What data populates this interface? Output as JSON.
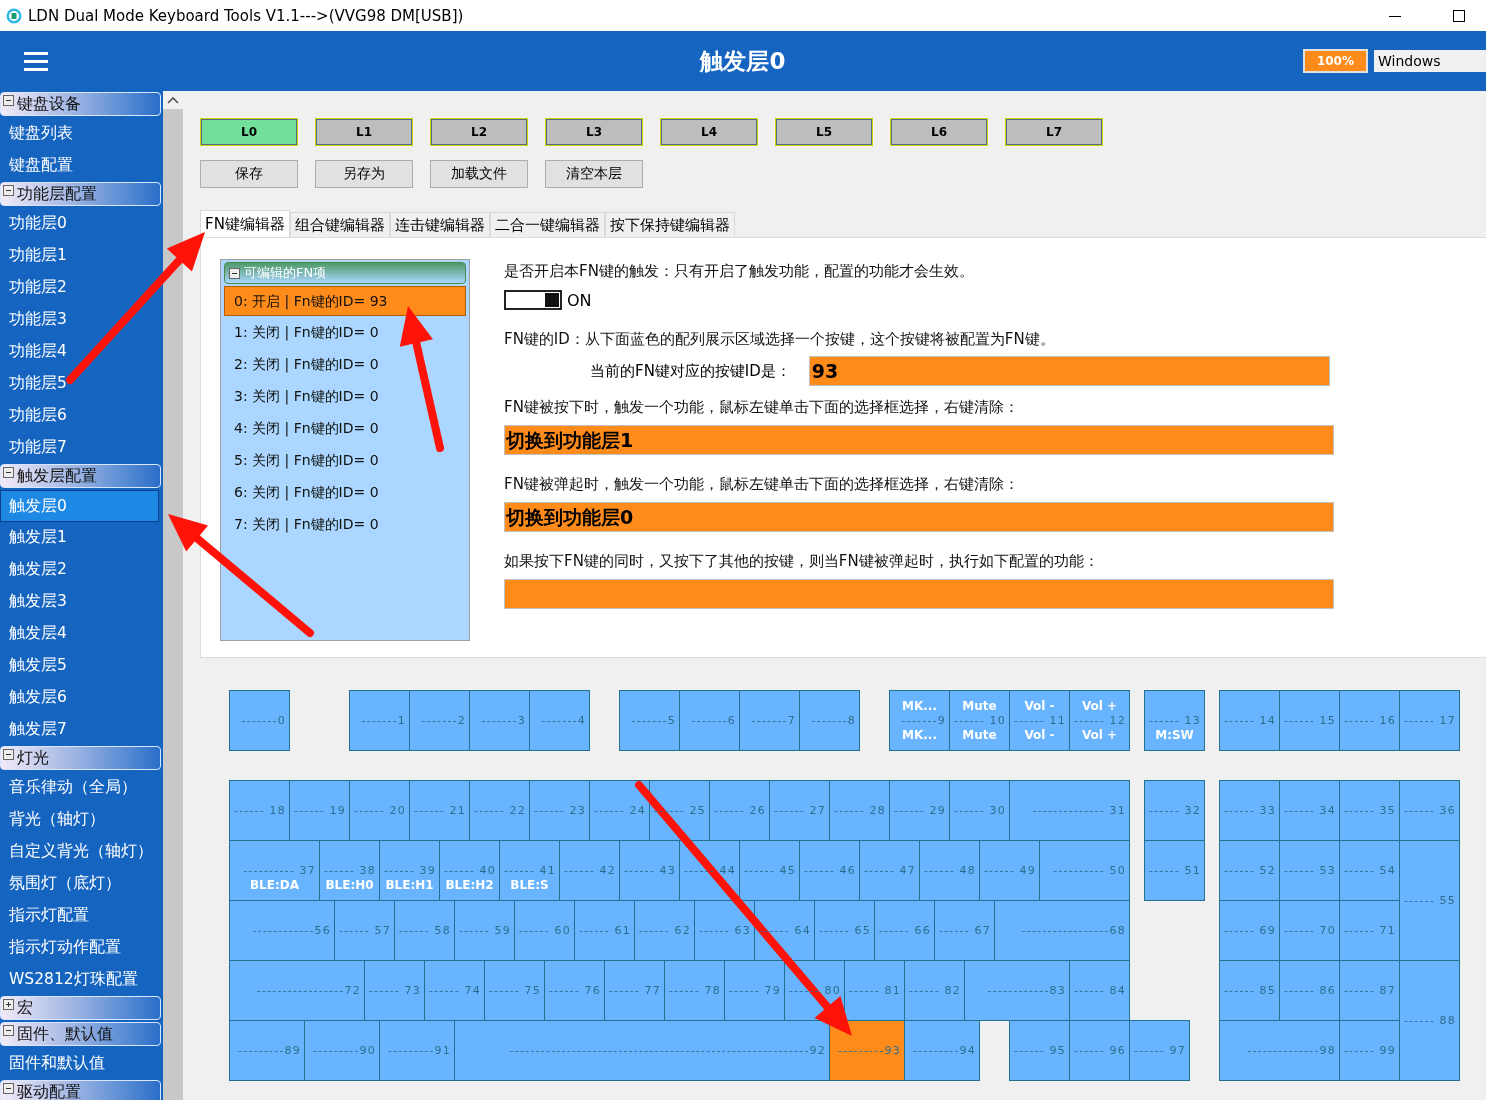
{
  "window": {
    "title": "LDN Dual Mode Keyboard Tools V1.1--->(VVG98 DM[USB])"
  },
  "header": {
    "title": "触发层0",
    "battery": "100%",
    "os": "Windows"
  },
  "sidebar": {
    "sections": [
      {
        "label": "键盘设备",
        "expanded": true,
        "children": [
          {
            "label": "键盘列表",
            "selected": false
          },
          {
            "label": "键盘配置",
            "selected": false
          }
        ]
      },
      {
        "label": "功能层配置",
        "expanded": true,
        "children": [
          {
            "label": "功能层0",
            "selected": false
          },
          {
            "label": "功能层1",
            "selected": false
          },
          {
            "label": "功能层2",
            "selected": false
          },
          {
            "label": "功能层3",
            "selected": false
          },
          {
            "label": "功能层4",
            "selected": false
          },
          {
            "label": "功能层5",
            "selected": false
          },
          {
            "label": "功能层6",
            "selected": false
          },
          {
            "label": "功能层7",
            "selected": false
          }
        ]
      },
      {
        "label": "触发层配置",
        "expanded": true,
        "children": [
          {
            "label": "触发层0",
            "selected": true
          },
          {
            "label": "触发层1",
            "selected": false
          },
          {
            "label": "触发层2",
            "selected": false
          },
          {
            "label": "触发层3",
            "selected": false
          },
          {
            "label": "触发层4",
            "selected": false
          },
          {
            "label": "触发层5",
            "selected": false
          },
          {
            "label": "触发层6",
            "selected": false
          },
          {
            "label": "触发层7",
            "selected": false
          }
        ]
      },
      {
        "label": "灯光",
        "expanded": true,
        "children": [
          {
            "label": "音乐律动（全局）",
            "selected": false
          },
          {
            "label": "背光（轴灯）",
            "selected": false
          },
          {
            "label": "自定义背光（轴灯）",
            "selected": false
          },
          {
            "label": "氛围灯（底灯）",
            "selected": false
          },
          {
            "label": "指示灯配置",
            "selected": false
          },
          {
            "label": "指示灯动作配置",
            "selected": false
          },
          {
            "label": "WS2812灯珠配置",
            "selected": false
          }
        ]
      },
      {
        "label": "宏",
        "expanded": false
      },
      {
        "label": "固件、默认值",
        "expanded": true,
        "children": [
          {
            "label": "固件和默认值",
            "selected": false
          }
        ]
      },
      {
        "label": "驱动配置",
        "expanded": true
      }
    ]
  },
  "layers": [
    {
      "label": "L0",
      "selected": true
    },
    {
      "label": "L1",
      "selected": false
    },
    {
      "label": "L2",
      "selected": false
    },
    {
      "label": "L3",
      "selected": false
    },
    {
      "label": "L4",
      "selected": false
    },
    {
      "label": "L5",
      "selected": false
    },
    {
      "label": "L6",
      "selected": false
    },
    {
      "label": "L7",
      "selected": false
    }
  ],
  "actions": [
    "保存",
    "另存为",
    "加载文件",
    "清空本层"
  ],
  "tabs": [
    {
      "label": "FN键编辑器",
      "selected": true
    },
    {
      "label": "组合键编辑器",
      "selected": false
    },
    {
      "label": "连击键编辑器",
      "selected": false
    },
    {
      "label": "二合一键编辑器",
      "selected": false
    },
    {
      "label": "按下保持键编辑器",
      "selected": false
    }
  ],
  "fn_list": {
    "title": "可编辑的FN项",
    "expanded": true,
    "items": [
      {
        "label": "0: 开启 | Fn键的ID= 93",
        "selected": true
      },
      {
        "label": "1: 关闭 | Fn键的ID= 0",
        "selected": false
      },
      {
        "label": "2: 关闭 | Fn键的ID= 0",
        "selected": false
      },
      {
        "label": "3: 关闭 | Fn键的ID= 0",
        "selected": false
      },
      {
        "label": "4: 关闭 | Fn键的ID= 0",
        "selected": false
      },
      {
        "label": "5: 关闭 | Fn键的ID= 0",
        "selected": false
      },
      {
        "label": "6: 关闭 | Fn键的ID= 0",
        "selected": false
      },
      {
        "label": "7: 关闭 | Fn键的ID= 0",
        "selected": false
      }
    ]
  },
  "fn_editor": {
    "enable_prompt": "是否开启本FN键的触发：只有开启了触发功能，配置的功能才会生效。",
    "toggle": {
      "on": true,
      "label": "ON"
    },
    "id_prompt": "FN键的ID：从下面蓝色的配列展示区域选择一个按键，这个按键将被配置为FN键。",
    "id_label": "当前的FN键对应的按键ID是：",
    "id_value": "93",
    "press_prompt": "FN键被按下时，触发一个功能，鼠标左键单击下面的选择框选择，右键清除：",
    "press_value": "切换到功能层1",
    "release_prompt": "FN键被弹起时，触发一个功能，鼠标左键单击下面的选择框选择，右键清除：",
    "release_value": "切换到功能层0",
    "combo_prompt": "如果按下FN键的同时，又按下了其他的按键，则当FN键被弹起时，执行如下配置的功能："
  },
  "keyboard": {
    "keys": [
      {
        "label": "-------0",
        "selected": false
      },
      {
        "label": "-------1",
        "selected": false
      },
      {
        "label": "-------2",
        "selected": false
      },
      {
        "label": "-------3",
        "selected": false
      },
      {
        "label": "-------4",
        "selected": false
      },
      {
        "label": "-------5",
        "selected": false
      },
      {
        "label": "-------6",
        "selected": false
      },
      {
        "label": "-------7",
        "selected": false
      },
      {
        "label": "-------8",
        "selected": false
      },
      {
        "label": "-------9",
        "top": "MK...",
        "bottom": "MK...",
        "selected": false
      },
      {
        "label": "------ 10",
        "top": "Mute",
        "bottom": "Mute",
        "selected": false
      },
      {
        "label": "------ 11",
        "top": "Vol -",
        "bottom": "Vol -",
        "selected": false
      },
      {
        "label": "------ 12",
        "top": "Vol +",
        "bottom": "Vol +",
        "selected": false
      },
      {
        "label": "------ 13",
        "bottom": "M:SW",
        "selected": false
      },
      {
        "label": "------ 14",
        "selected": false
      },
      {
        "label": "------ 15",
        "selected": false
      },
      {
        "label": "------ 16",
        "selected": false
      },
      {
        "label": "------ 17",
        "selected": false
      },
      {
        "label": "------ 18",
        "selected": false
      },
      {
        "label": "------ 19",
        "selected": false
      },
      {
        "label": "------ 20",
        "selected": false
      },
      {
        "label": "------ 21",
        "selected": false
      },
      {
        "label": "------ 22",
        "selected": false
      },
      {
        "label": "------ 23",
        "selected": false
      },
      {
        "label": "------ 24",
        "selected": false
      },
      {
        "label": "------ 25",
        "selected": false
      },
      {
        "label": "------ 26",
        "selected": false
      },
      {
        "label": "------ 27",
        "selected": false
      },
      {
        "label": "------ 28",
        "selected": false
      },
      {
        "label": "------ 29",
        "selected": false
      },
      {
        "label": "------ 30",
        "selected": false
      },
      {
        "label": "-------------- 31",
        "selected": false
      },
      {
        "label": "------ 32",
        "selected": false
      },
      {
        "label": "------ 33",
        "selected": false
      },
      {
        "label": "------ 34",
        "selected": false
      },
      {
        "label": "------ 35",
        "selected": false
      },
      {
        "label": "------ 36",
        "selected": false
      },
      {
        "label": "---------- 37",
        "bottom": "BLE:DA",
        "selected": false
      },
      {
        "label": "------ 38",
        "bottom": "BLE:H0",
        "selected": false
      },
      {
        "label": "------ 39",
        "bottom": "BLE:H1",
        "selected": false
      },
      {
        "label": "------ 40",
        "bottom": "BLE:H2",
        "selected": false
      },
      {
        "label": "------ 41",
        "bottom": "BLE:S",
        "selected": false
      },
      {
        "label": "------ 42",
        "selected": false
      },
      {
        "label": "------ 43",
        "selected": false
      },
      {
        "label": "------ 44",
        "selected": false
      },
      {
        "label": "------ 45",
        "selected": false
      },
      {
        "label": "------ 46",
        "selected": false
      },
      {
        "label": "------ 47",
        "selected": false
      },
      {
        "label": "------ 48",
        "selected": false
      },
      {
        "label": "------ 49",
        "selected": false
      },
      {
        "label": "---------- 50",
        "selected": false
      },
      {
        "label": "------ 51",
        "selected": false
      },
      {
        "label": "------ 52",
        "selected": false
      },
      {
        "label": "------ 53",
        "selected": false
      },
      {
        "label": "------ 54",
        "selected": false
      },
      {
        "label": "------ 55",
        "selected": false
      },
      {
        "label": "------------56",
        "selected": false
      },
      {
        "label": "------ 57",
        "selected": false
      },
      {
        "label": "------ 58",
        "selected": false
      },
      {
        "label": "------ 59",
        "selected": false
      },
      {
        "label": "------ 60",
        "selected": false
      },
      {
        "label": "------ 61",
        "selected": false
      },
      {
        "label": "------ 62",
        "selected": false
      },
      {
        "label": "------ 63",
        "selected": false
      },
      {
        "label": "------ 64",
        "selected": false
      },
      {
        "label": "------ 65",
        "selected": false
      },
      {
        "label": "------ 66",
        "selected": false
      },
      {
        "label": "------ 67",
        "selected": false
      },
      {
        "label": "-----------------68",
        "selected": false
      },
      {
        "label": "------ 69",
        "selected": false
      },
      {
        "label": "------ 70",
        "selected": false
      },
      {
        "label": "------ 71",
        "selected": false
      },
      {
        "label": "-----------------72",
        "selected": false
      },
      {
        "label": "------ 73",
        "selected": false
      },
      {
        "label": "------ 74",
        "selected": false
      },
      {
        "label": "------ 75",
        "selected": false
      },
      {
        "label": "------ 76",
        "selected": false
      },
      {
        "label": "------ 77",
        "selected": false
      },
      {
        "label": "------ 78",
        "selected": false
      },
      {
        "label": "------ 79",
        "selected": false
      },
      {
        "label": "------ 80",
        "selected": false
      },
      {
        "label": "------ 81",
        "selected": false
      },
      {
        "label": "------ 82",
        "selected": false
      },
      {
        "label": "------------83",
        "selected": false
      },
      {
        "label": "------ 84",
        "selected": false
      },
      {
        "label": "------ 85",
        "selected": false
      },
      {
        "label": "------ 86",
        "selected": false
      },
      {
        "label": "------ 87",
        "selected": false
      },
      {
        "label": "------ 88",
        "selected": false
      },
      {
        "label": "---------89",
        "selected": false
      },
      {
        "label": "---------90",
        "selected": false
      },
      {
        "label": "---------91",
        "selected": false
      },
      {
        "label": "----------------------------------------------------------92",
        "selected": false
      },
      {
        "label": "---------93",
        "selected": true
      },
      {
        "label": "---------94",
        "selected": false
      },
      {
        "label": "------ 95",
        "selected": false
      },
      {
        "label": "------ 96",
        "selected": false
      },
      {
        "label": "------ 97",
        "selected": false
      },
      {
        "label": "--------------98",
        "selected": false
      },
      {
        "label": "------ 99",
        "selected": false
      }
    ]
  }
}
